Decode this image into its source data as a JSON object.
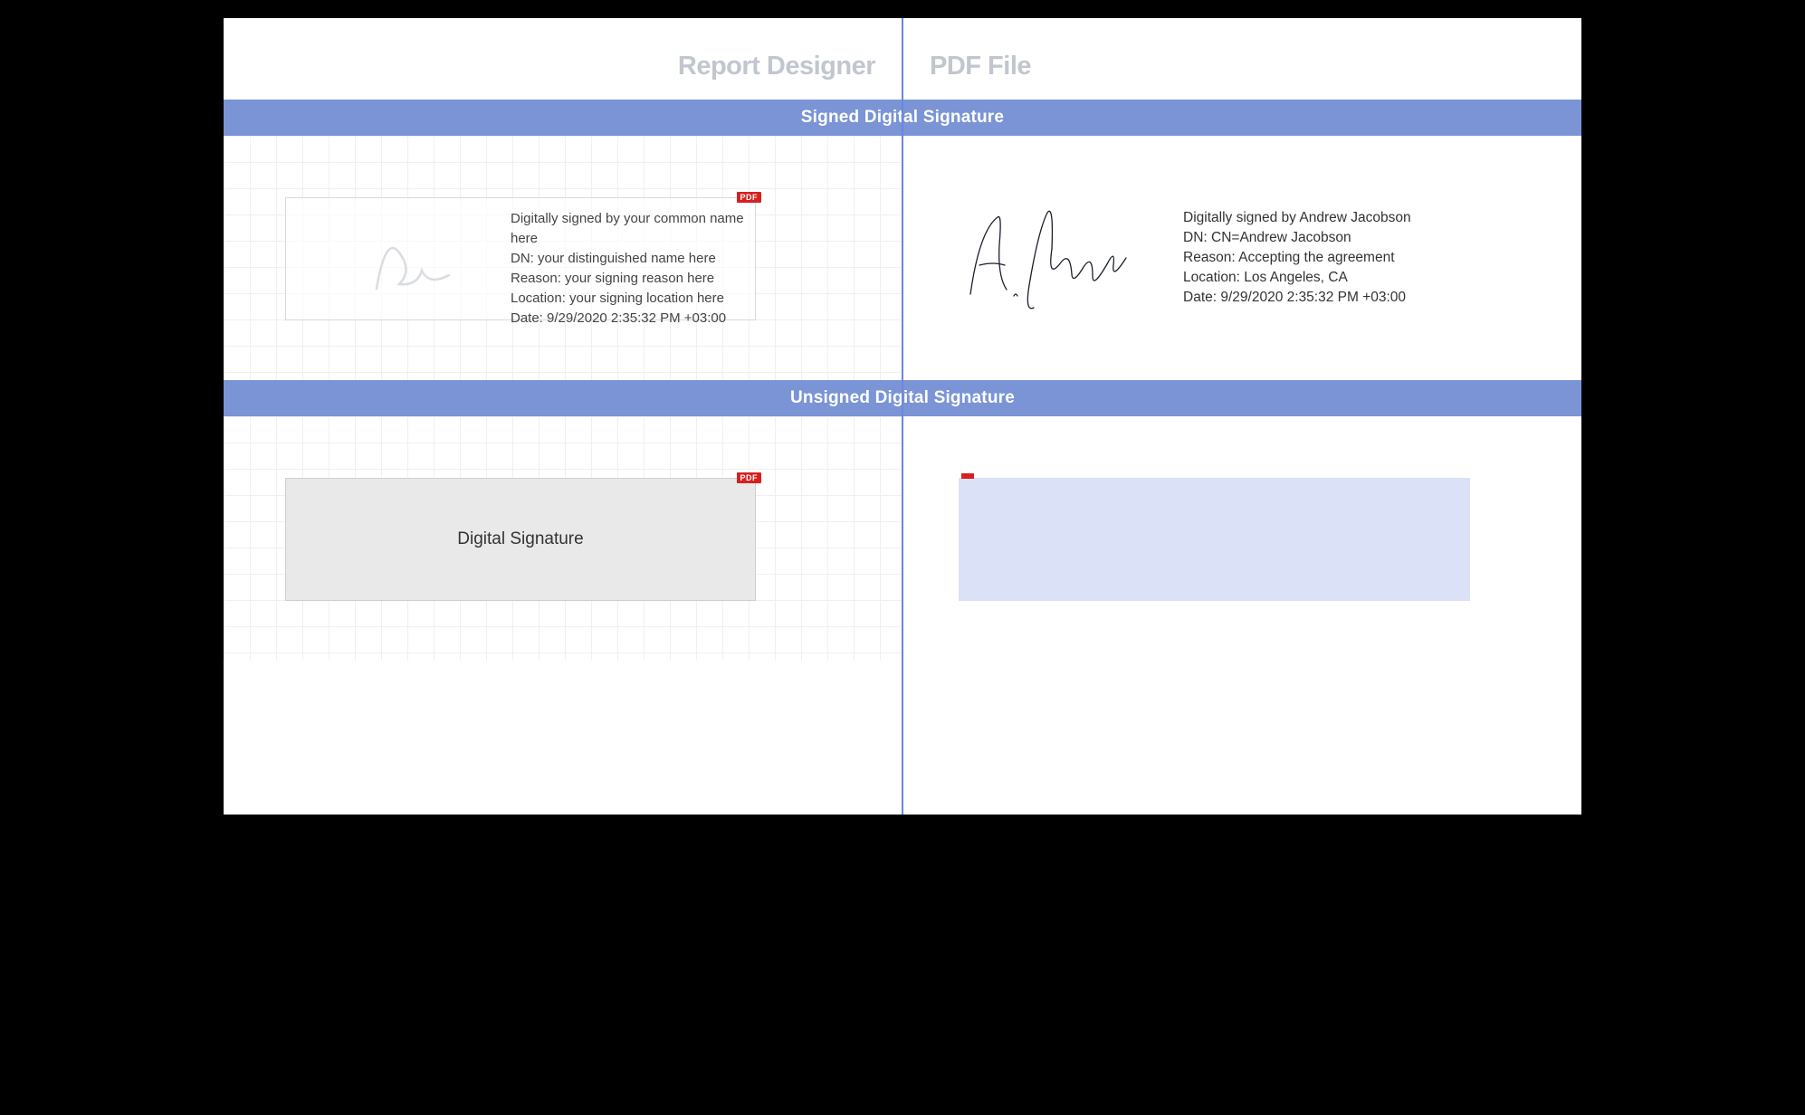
{
  "headers": {
    "left": "Report Designer",
    "right": "PDF File"
  },
  "sections": {
    "signed_title": "Signed Digital Signature",
    "unsigned_title": "Unsigned Digital Signature"
  },
  "designer_signed": {
    "line1": "Digitally signed by your common name here",
    "line2": "DN: your distinguished name here",
    "line3": "Reason: your signing reason here",
    "line4": "Location: your signing location here",
    "line5": "Date: 9/29/2020 2:35:32 PM +03:00"
  },
  "pdf_signed": {
    "line1": "Digitally signed by Andrew Jacobson",
    "line2": "DN: CN=Andrew Jacobson",
    "line3": "Reason: Accepting the agreement",
    "line4": "Location: Los Angeles, CA",
    "line5": "Date: 9/29/2020 2:35:32 PM +03:00"
  },
  "designer_unsigned": {
    "label": "Digital Signature"
  },
  "badge": "PDF"
}
